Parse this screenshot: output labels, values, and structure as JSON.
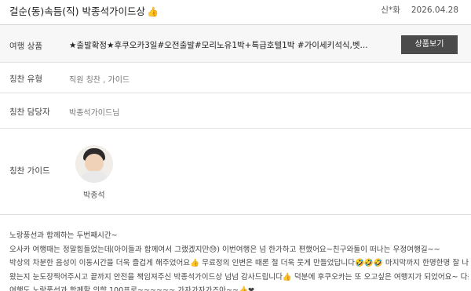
{
  "header": {
    "title": "걸순(동)속듬(직) 박종석가이드상",
    "author": "신*화",
    "date": "2026.04.28"
  },
  "details": {
    "product_label": "여행 상품",
    "product_value": "★출발확정★후쿠오카3일#오전출발#모리노유1박+특급호텔1박 #가이세키석식,벳...",
    "product_button": "상품보기",
    "type_label": "칭찬 유형",
    "type_value": "직원 칭찬 , 가이드",
    "staff_label": "칭찬 담당자",
    "staff_value": "박종석가이드님",
    "guide_label": "칭찬 가이드",
    "guide_name": "박종석"
  },
  "review": {
    "line1": "노랑풍선과 함께하는 두번째시간~",
    "line2": "오사카 여행때는 정말힘들었는데(아이들과 함께여서 그랬겠지만😓) 이번여행은 넘 한가하고 편했어요~친구와둘이 떠나는 우정여행길~~",
    "line3": "박상의 차분한 음성이 이동시간을 더욱 즐겁게 해주었어요👍 무료정의 인변은 때론 절 더욱 웃게 만들었답니다🤣🤣🤣 마지막까지 한명한명 잘 나",
    "line4": "왔는지 눈도장찍어주시고 끝까지 안전을 책임져주신 박종석가이드상 넘넘 감사드립니다👍 덕분에 후쿠오카는 또 오고싶은 여행지가 되었어요~ 다음",
    "line5": "여행도 노랑풍선과 함께할 의향 100프로~~~~~~ 가자가자가즈아~~👍❤"
  }
}
